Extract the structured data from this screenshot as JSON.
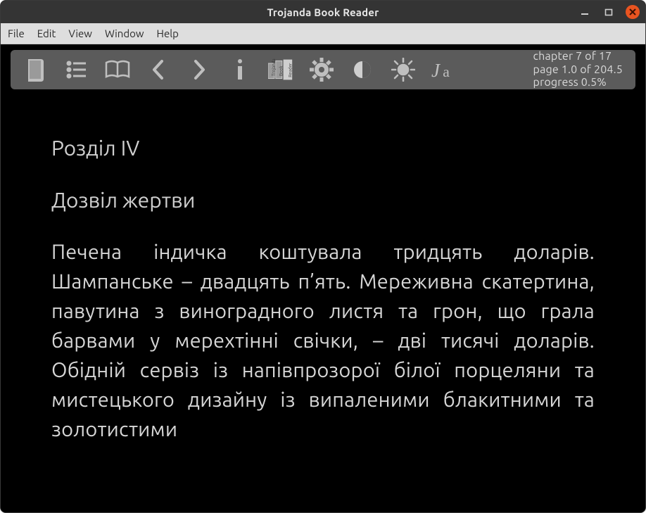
{
  "window": {
    "title": "Trojanda Book Reader"
  },
  "menubar": {
    "items": [
      {
        "label": "File"
      },
      {
        "label": "Edit"
      },
      {
        "label": "View"
      },
      {
        "label": "Window"
      },
      {
        "label": "Help"
      }
    ]
  },
  "toolbar": {
    "icons": {
      "open_book": "open-book-icon",
      "toc": "toc-list-icon",
      "two_page": "two-page-icon",
      "prev": "chevron-left-icon",
      "next": "chevron-right-icon",
      "info": "info-icon",
      "logo": "app-logo-icon",
      "settings": "gear-icon",
      "contrast": "contrast-icon",
      "brightness": "brightness-icon",
      "typography": "typography-icon"
    }
  },
  "status": {
    "chapter": "chapter 7 of 17",
    "page": "page 1.0 of 204.5",
    "progress": "progress 0.5%"
  },
  "reader": {
    "chapter_title": "Розділ IV",
    "chapter_subtitle": "Дозвіл жертви",
    "paragraph_1": "Печена індичка коштувала тридцять доларів. Шампанське – двадцять п’ять. Мереживна скатертина, павутина з виноградного листя та грон, що грала барвами у мерехтінні свічки, – дві тисячі доларів. Обідній сервіз із напівпрозорої білої порцеляни та мистецького дизайну із випаленими блакитними та золотистими"
  },
  "colors": {
    "accent_close": "#e95420",
    "toolbar_bg": "#5b5b5b",
    "content_bg": "#000000",
    "content_text": "#d6d6d6"
  }
}
